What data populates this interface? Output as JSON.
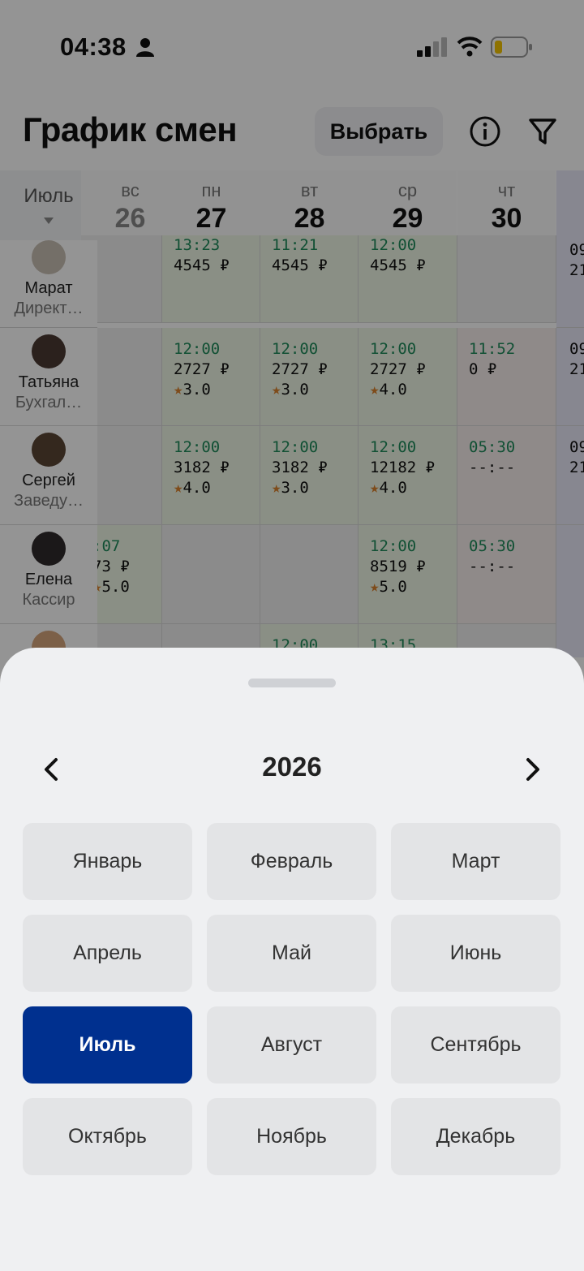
{
  "status_bar": {
    "time": "04:38"
  },
  "header": {
    "title": "График смен",
    "select_label": "Выбрать"
  },
  "schedule": {
    "month": "Июль",
    "days": [
      {
        "name": "вс",
        "date": "26"
      },
      {
        "name": "пн",
        "date": "27"
      },
      {
        "name": "вт",
        "date": "28"
      },
      {
        "name": "ср",
        "date": "29"
      },
      {
        "name": "чт",
        "date": "30"
      }
    ],
    "employees": [
      {
        "name": "Марат",
        "role": "Директ…",
        "shifts": [
          "",
          "13:23|4545 ₽",
          "11:21|4545 ₽",
          "12:00|4545 ₽",
          ""
        ],
        "extra": "09|21"
      },
      {
        "name": "Татьяна",
        "role": "Бухгал…",
        "shifts": [
          "",
          "12:00|2727 ₽|3.0",
          "12:00|2727 ₽|3.0",
          "12:00|2727 ₽|4.0",
          "11:52|0 ₽"
        ],
        "extra": "09|21"
      },
      {
        "name": "Сергей",
        "role": "Заведу…",
        "shifts": [
          "",
          "12:00|3182 ₽|4.0",
          "12:00|3182 ₽|3.0",
          "12:00|12182 ₽|4.0",
          "05:30|--:--"
        ],
        "extra": "09|21"
      },
      {
        "name": "Елена",
        "role": "Кассир",
        "shifts": [
          ":07|73 ₽|5.0",
          "",
          "",
          "12:00|8519 ₽|5.0",
          "05:30|--:--"
        ],
        "extra": ""
      },
      {
        "name": "",
        "role": "",
        "shifts": [
          "",
          "",
          "12:00",
          "13:15",
          ""
        ],
        "extra": ""
      }
    ]
  },
  "picker": {
    "year": "2026",
    "months": [
      "Январь",
      "Февраль",
      "Март",
      "Апрель",
      "Май",
      "Июнь",
      "Июль",
      "Август",
      "Сентябрь",
      "Октябрь",
      "Ноябрь",
      "Декабрь"
    ],
    "selected_month": "Июль"
  },
  "colors": {
    "accent": "#00308f",
    "shift_time": "#1e8a5a",
    "star": "#d9812d"
  }
}
